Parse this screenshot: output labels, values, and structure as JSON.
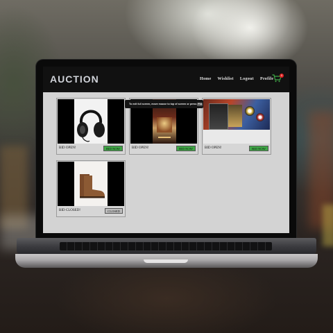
{
  "app": {
    "brand": "AUCTION",
    "nav": [
      "Home",
      "Wishlist",
      "Logout",
      "Profile"
    ],
    "cart_count": "0"
  },
  "fullscreen_notice": {
    "text": "To exit full screen, move mouse to top of screen or press",
    "key": "F11"
  },
  "items": [
    {
      "status": "BID OPEN!",
      "button": "BID NOW",
      "button_state": "open",
      "image": "headphones"
    },
    {
      "status": "BID OPEN!",
      "button": "BID NOW",
      "button_state": "open",
      "image": "book-cover"
    },
    {
      "status": "BID OPEN!",
      "button": "BID NOW",
      "button_state": "open",
      "image": "video-game-box"
    },
    {
      "status": "BID CLOSED!",
      "button": "CLOSED",
      "button_state": "closed",
      "image": "brown-boots"
    }
  ],
  "colors": {
    "navbar": "#111111",
    "content_bg": "#d3d3d3",
    "bid_open_button": "#3fa846",
    "closed_button": "#bdbdbd",
    "cart_badge": "#e12222"
  }
}
